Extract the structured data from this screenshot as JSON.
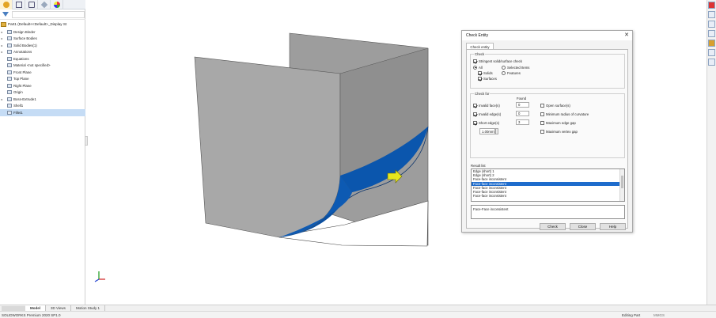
{
  "feature_manager": {
    "root_label": "Part1  (Default<<Default>_Display St",
    "items": [
      {
        "label": "Design Binder",
        "expandable": true,
        "selected": false
      },
      {
        "label": "Surface Bodies",
        "expandable": true,
        "selected": false
      },
      {
        "label": "Solid Bodies(1)",
        "expandable": true,
        "selected": false
      },
      {
        "label": "Annotations",
        "expandable": true,
        "selected": false
      },
      {
        "label": "Equations",
        "expandable": false,
        "selected": false
      },
      {
        "label": "Material <not specified>",
        "expandable": false,
        "selected": false
      },
      {
        "label": "Front Plane",
        "expandable": false,
        "selected": false
      },
      {
        "label": "Top Plane",
        "expandable": false,
        "selected": false
      },
      {
        "label": "Right Plane",
        "expandable": false,
        "selected": false
      },
      {
        "label": "Origin",
        "expandable": false,
        "selected": false
      },
      {
        "label": "Boss-Extrude1",
        "expandable": true,
        "selected": false
      },
      {
        "label": "Shell1",
        "expandable": false,
        "selected": false
      },
      {
        "label": "Fillet1",
        "expandable": false,
        "selected": true
      }
    ]
  },
  "bottom_tabs": [
    {
      "label": "Model",
      "active": true
    },
    {
      "label": "3D Views",
      "active": false
    },
    {
      "label": "Motion Study 1",
      "active": false
    }
  ],
  "status_bar": {
    "left": "SOLIDWORKS Premium 2020 SP1.0",
    "right": "Editing Part",
    "units": "MMGS"
  },
  "colors": {
    "accent_blue": "#1e6ccc",
    "face_gray": "#a5a5a5",
    "fillet_blue": "#0a4fa0",
    "arrow_yellow": "#e6e61e"
  },
  "dialog": {
    "title": "Check Entity",
    "tab": "Check entity",
    "check_group": "Check",
    "strict_check": "Stringent solid/surface check",
    "all_label": "All",
    "solids_label": "Solids",
    "surfaces_label": "Surfaces",
    "selected_items_label": "Selected Items",
    "features_label": "Features",
    "check_for_group": "Check for",
    "found_header": "Found",
    "invalid_faces": "Invalid face(s)",
    "invalid_edges": "Invalid edge(s)",
    "short_edges": "Short edge(s)",
    "invalid_faces_count": "0",
    "invalid_edges_count": "0",
    "short_edges_count": "3",
    "short_edge_length": "1.00mm",
    "open_surfaces": "Open surface(s)",
    "min_radius": "Minimum radius of curvature",
    "max_edge_gap": "Maximum edge gap",
    "max_vertex_gap": "Maximum vertex gap",
    "result_list_label": "Result list",
    "results": [
      {
        "label": "Edge (short) 1",
        "selected": false
      },
      {
        "label": "Edge (short) 2",
        "selected": false
      },
      {
        "label": "Face-face inconsistent",
        "selected": false
      },
      {
        "label": "Face-face inconsistent",
        "selected": true
      },
      {
        "label": "Face-face inconsistent",
        "selected": false
      },
      {
        "label": "Face-face inconsistent",
        "selected": false
      },
      {
        "label": "Face-face inconsistent",
        "selected": false
      }
    ],
    "description": "Face-Face inconsistent",
    "check_button": "Check",
    "close_button": "Close",
    "help_button": "Help"
  }
}
